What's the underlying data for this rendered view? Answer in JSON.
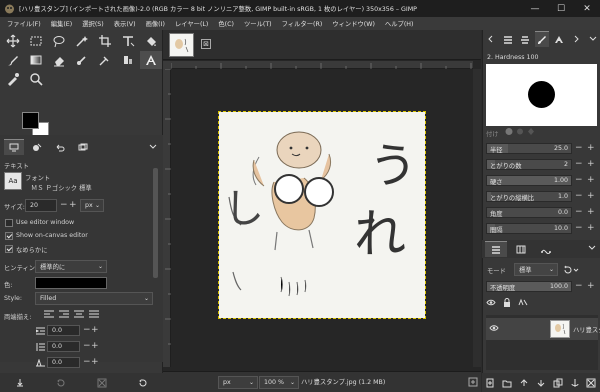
{
  "window": {
    "title": "[ハリ豊スタンプ] (インポートされた画像)-2.0 (RGB カラー 8 bit ノンリニア整数, GIMP built-in sRGB, 1 枚のレイヤー) 350x356 – GIMP",
    "minimize": "—",
    "maximize": "☐",
    "close": "✕"
  },
  "menu": [
    "ファイル(F)",
    "編集(E)",
    "選択(S)",
    "表示(V)",
    "画像(I)",
    "レイヤー(L)",
    "色(C)",
    "ツール(T)",
    "フィルター(R)",
    "ウィンドウ(W)",
    "ヘルプ(H)"
  ],
  "tool_options": {
    "section": "テキスト",
    "font_label": "フォント",
    "font_value": "ＭＳ Ｐゴシック 標準",
    "font_preview": "Aa",
    "size_label": "サイズ:",
    "size_value": "20",
    "size_unit": "px",
    "use_editor": "Use editor window",
    "show_on_canvas": "Show on-canvas editor",
    "antialias": "なめらかに",
    "hinting_label": "ヒンティング:",
    "hinting_value": "標準的に",
    "color_label": "色:",
    "style_label": "Style:",
    "style_value": "Filled",
    "justify_label": "両端揃え:",
    "indent_value": "0.0",
    "line_value": "0.0",
    "letter_value": "0.0"
  },
  "statusbar": {
    "unit": "px",
    "zoom": "100 %",
    "filename": "ハリ豊スタンプ.jpg (1.2 MB)"
  },
  "brushes": {
    "name": "2. Hardness 100",
    "tag_label": "付け"
  },
  "paint_dynamics": [
    {
      "label": "半径",
      "value": "25.0",
      "frac": 0.25
    },
    {
      "label": "とがりの数",
      "value": "2",
      "frac": 0.1
    },
    {
      "label": "硬さ",
      "value": "1.00",
      "frac": 1.0
    },
    {
      "label": "とがりの縦横比",
      "value": "1.0",
      "frac": 0.05
    },
    {
      "label": "角度",
      "value": "0.0",
      "frac": 0.0
    },
    {
      "label": "間隔",
      "value": "10.0",
      "frac": 0.1
    }
  ],
  "layers": {
    "mode_label": "モード",
    "mode_value": "標準",
    "opacity_label": "不透明度",
    "opacity_value": "100.0",
    "lock_label": "保護:",
    "layer_name": "ハリ豊スタンプ"
  },
  "image_text": {
    "u": "う",
    "re": "れ",
    "shi": "し"
  }
}
